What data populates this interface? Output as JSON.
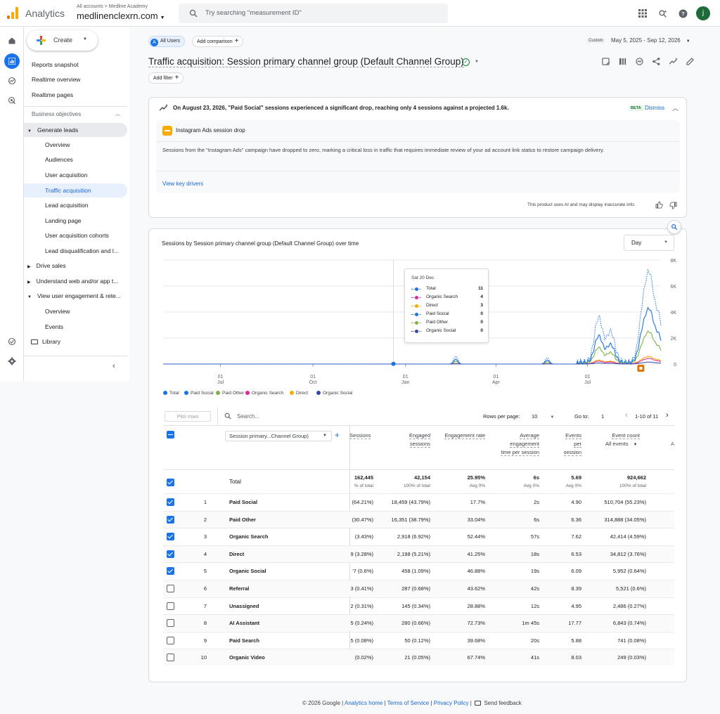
{
  "header": {
    "app_name": "Analytics",
    "breadcrumb": "All accounts > Medline Academy",
    "property": "medlinenclexrn.com",
    "search_placeholder": "Try searching \"measurement ID\"",
    "avatar_letter": "j"
  },
  "sidebar": {
    "create_label": "Create",
    "items": [
      {
        "label": "Reports snapshot"
      },
      {
        "label": "Realtime overview"
      },
      {
        "label": "Realtime pages"
      }
    ],
    "section_label": "Business objectives",
    "generate_leads": "Generate leads",
    "sub_items": [
      {
        "label": "Overview"
      },
      {
        "label": "Audiences"
      },
      {
        "label": "User acquisition"
      },
      {
        "label": "Traffic acquisition"
      },
      {
        "label": "Lead acquisition"
      },
      {
        "label": "Landing page"
      },
      {
        "label": "User acquisition cohorts"
      },
      {
        "label": "Lead disqualification and l..."
      }
    ],
    "drive_sales": "Drive sales",
    "understand": "Understand web and/or app t...",
    "view_engagement": "View user engagement & rete...",
    "engagement_items": [
      {
        "label": "Overview"
      },
      {
        "label": "Events"
      }
    ],
    "library": "Library"
  },
  "filters": {
    "all_users": "All Users",
    "add_comparison": "Add comparison",
    "custom": "Custom",
    "date_range": "May 5, 2025 - Sep 12, 2026",
    "add_filter": "Add filter"
  },
  "page_title": "Traffic acquisition: Session primary channel group (Default Channel Group)",
  "insight": {
    "headline": "On August 23, 2026, \"Paid Social\" sessions experienced a significant drop, reaching only 4 sessions against a projected 1.6k.",
    "beta": "BETA",
    "dismiss": "Dismiss",
    "subtitle": "Instagram Ads session drop",
    "body": "Sessions from the \"Instagram Ads\" campaign have dropped to zero, marking a critical loss in traffic that requires immediate review of your ad account link status to restore campaign delivery.",
    "link": "View key drivers",
    "disclaimer": "This product uses AI and may display inaccurate info."
  },
  "chart_data": {
    "type": "line",
    "title": "Sessions by Session primary channel group (Default Channel Group) over time",
    "granularity": "Day",
    "y_ticks": [
      "8K",
      "6K",
      "4K",
      "2K",
      "0"
    ],
    "ylim": [
      0,
      8000
    ],
    "x_ticks": [
      {
        "day": "01",
        "month": "Jul"
      },
      {
        "day": "01",
        "month": "Oct"
      },
      {
        "day": "01",
        "month": "Jan"
      },
      {
        "day": "01",
        "month": "Apr"
      },
      {
        "day": "01",
        "month": "Jul"
      }
    ],
    "series": [
      {
        "name": "Total",
        "color": "#1a73e8"
      },
      {
        "name": "Paid Social",
        "color": "#1a73e8"
      },
      {
        "name": "Paid Other",
        "color": "#7cb342"
      },
      {
        "name": "Organic Search",
        "color": "#e52592"
      },
      {
        "name": "Direct",
        "color": "#f9ab00"
      },
      {
        "name": "Organic Social",
        "color": "#3949ab"
      }
    ],
    "tooltip": {
      "date": "Sat 20 Dec",
      "rows": [
        {
          "name": "Total",
          "value": "11",
          "color": "#1a73e8"
        },
        {
          "name": "Organic Search",
          "value": "4",
          "color": "#e52592"
        },
        {
          "name": "Direct",
          "value": "3",
          "color": "#f9ab00"
        },
        {
          "name": "Paid Social",
          "value": "0",
          "color": "#1a73e8"
        },
        {
          "name": "Paid Other",
          "value": "0",
          "color": "#7cb342"
        },
        {
          "name": "Organic Social",
          "value": "0",
          "color": "#3949ab"
        }
      ]
    },
    "spikes": [
      {
        "date": "2025-12-20",
        "value": 11
      },
      {
        "date": "2026-02-20",
        "value": 600
      },
      {
        "date": "2026-05-22",
        "value": 500
      },
      {
        "date": "2026-07-12",
        "value": 3400
      },
      {
        "date": "2026-07-24",
        "value": 2300
      },
      {
        "date": "2026-08-25",
        "value": 3600
      },
      {
        "date": "2026-09-01",
        "value": 5800
      },
      {
        "date": "2026-09-10",
        "value": 3200
      }
    ]
  },
  "table": {
    "plot_rows": "Plot rows",
    "search_placeholder": "Search...",
    "rows_per_page_label": "Rows per page:",
    "rows_per_page": "10",
    "goto_label": "Go to:",
    "goto_value": "1",
    "pagination": "1-10 of 11",
    "dimension_label": "Session primary...Channel Group)",
    "columns": [
      {
        "label": "Sessions"
      },
      {
        "label": "Engaged sessions"
      },
      {
        "label": "Engagement rate"
      },
      {
        "label": "Average engagement time per session"
      },
      {
        "label": "Events per session"
      },
      {
        "label": "Event count"
      }
    ],
    "event_filter": "All events",
    "more_col": "A",
    "total": {
      "label": "Total",
      "sessions": "162,445",
      "sessions_sub": "% of total",
      "engaged": "42,154",
      "engaged_sub": "100% of total",
      "rate": "25.95%",
      "rate_sub": "Avg 0%",
      "time": "6s",
      "time_sub": "Avg 0%",
      "eps": "5.69",
      "eps_sub": "Avg 0%",
      "events": "924,662",
      "events_sub": "100% of total"
    },
    "rows": [
      {
        "n": "1",
        "name": "Paid Social",
        "sessions": "(64.21%)",
        "engaged": "18,459 (43.79%)",
        "rate": "17.7%",
        "time": "2s",
        "eps": "4.90",
        "events": "510,704 (55.23%)",
        "checked": true
      },
      {
        "n": "2",
        "name": "Paid Other",
        "sessions": "(30.47%)",
        "engaged": "16,351 (38.79%)",
        "rate": "33.04%",
        "time": "6s",
        "eps": "6.36",
        "events": "314,888 (34.05%)",
        "checked": true
      },
      {
        "n": "3",
        "name": "Organic Search",
        "sessions": " (3.43%)",
        "engaged": "2,918 (6.92%)",
        "rate": "52.44%",
        "time": "57s",
        "eps": "7.62",
        "events": "42,414 (4.59%)",
        "checked": true
      },
      {
        "n": "4",
        "name": "Direct",
        "sessions": "9 (3.28%)",
        "engaged": "2,198 (5.21%)",
        "rate": "41.25%",
        "time": "18s",
        "eps": "6.53",
        "events": "34,812 (3.76%)",
        "checked": true
      },
      {
        "n": "5",
        "name": "Organic Social",
        "sessions": "'7 (0.6%)",
        "engaged": "458 (1.09%)",
        "rate": "46.88%",
        "time": "19s",
        "eps": "6.09",
        "events": "5,952 (0.64%)",
        "checked": true
      },
      {
        "n": "6",
        "name": "Referral",
        "sessions": "3 (0.41%)",
        "engaged": "287 (0.68%)",
        "rate": "43.62%",
        "time": "42s",
        "eps": "8.39",
        "events": "5,521 (0.6%)",
        "checked": false
      },
      {
        "n": "7",
        "name": "Unassigned",
        "sessions": "2 (0.31%)",
        "engaged": "145 (0.34%)",
        "rate": "28.88%",
        "time": "12s",
        "eps": "4.95",
        "events": "2,486 (0.27%)",
        "checked": false
      },
      {
        "n": "8",
        "name": "AI Assistant",
        "sessions": "5 (0.24%)",
        "engaged": "280 (0.66%)",
        "rate": "72.73%",
        "time": "1m 45s",
        "eps": "17.77",
        "events": "6,843 (0.74%)",
        "checked": false
      },
      {
        "n": "9",
        "name": "Paid Search",
        "sessions": "5 (0.08%)",
        "engaged": "50 (0.12%)",
        "rate": "39.68%",
        "time": "20s",
        "eps": "5.88",
        "events": "741 (0.08%)",
        "checked": false
      },
      {
        "n": "10",
        "name": "Organic Video",
        "sessions": "(0.02%)",
        "engaged": "21 (0.05%)",
        "rate": "67.74%",
        "time": "41s",
        "eps": "8.03",
        "events": "249 (0.03%)",
        "checked": false
      }
    ]
  },
  "footer": {
    "copyright": "© 2026 Google |",
    "analytics_home": "Analytics home",
    "terms": "Terms of Service",
    "privacy": "Privacy Policy",
    "feedback": "Send feedback"
  },
  "colors": {
    "accent": "#1a73e8",
    "active_bg": "#e8f0fe",
    "logo_orange": "#f9ab00",
    "logo_dark": "#e37400"
  }
}
